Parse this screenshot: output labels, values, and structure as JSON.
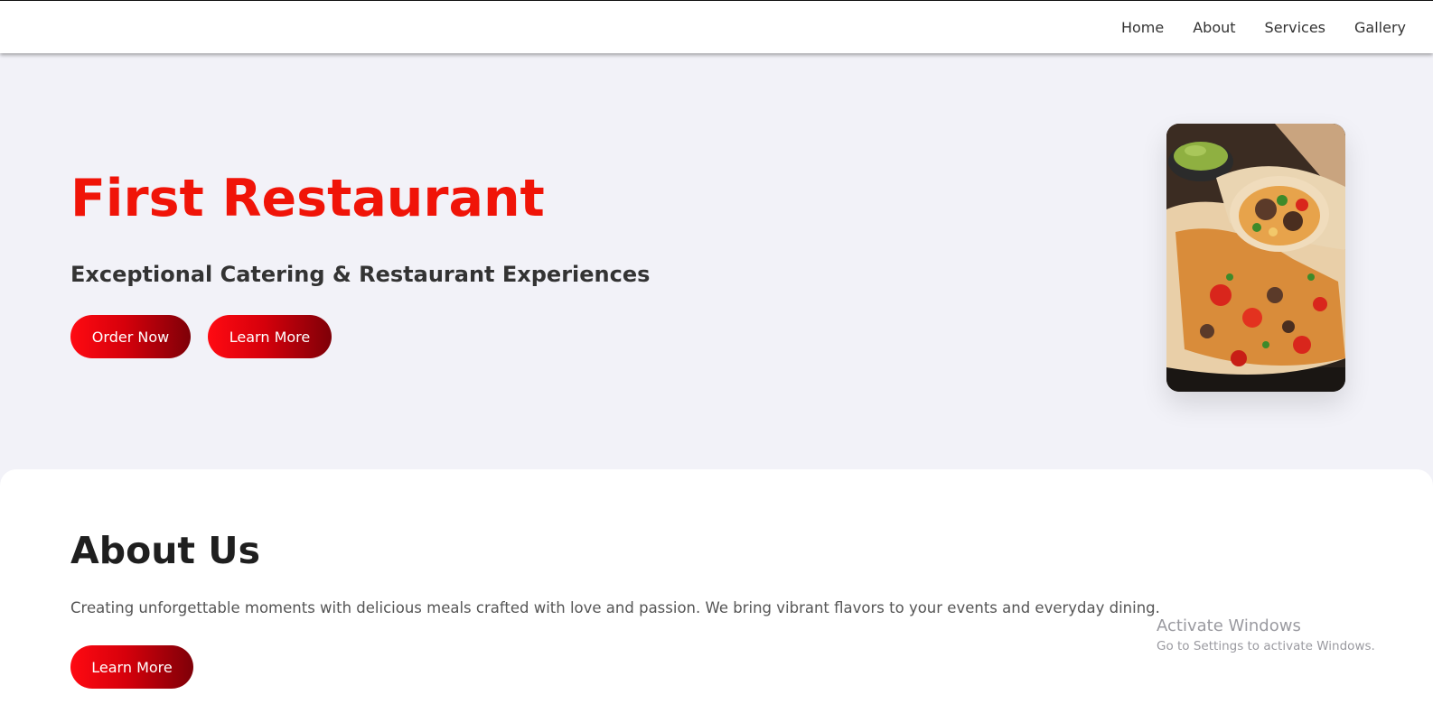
{
  "nav": {
    "items": [
      {
        "label": "Home"
      },
      {
        "label": "About"
      },
      {
        "label": "Services"
      },
      {
        "label": "Gallery"
      }
    ]
  },
  "hero": {
    "title": "First Restaurant",
    "subtitle": "Exceptional Catering & Restaurant Experiences",
    "order_button": "Order Now",
    "learn_button": "Learn More"
  },
  "about": {
    "title": "About Us",
    "text": "Creating unforgettable moments with delicious meals crafted with love and passion. We bring vibrant flavors to your events and everyday dining.",
    "button": "Learn More"
  },
  "watermark": {
    "title": "Activate Windows",
    "subtitle": "Go to Settings to activate Windows."
  },
  "colors": {
    "accent": "#f01408",
    "button_start": "#ff0a12",
    "button_end": "#7e0008",
    "background": "#f2f2f8"
  }
}
